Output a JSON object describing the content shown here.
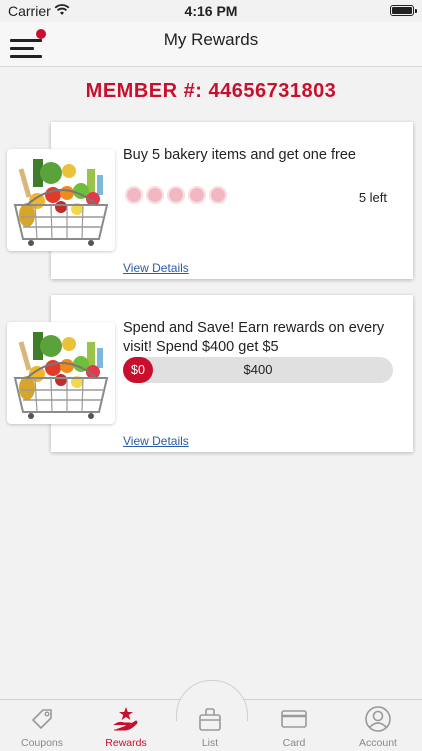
{
  "status": {
    "carrier": "Carrier",
    "time": "4:16 PM"
  },
  "nav": {
    "title": "My Rewards",
    "menu_icon": "hamburger-menu-icon",
    "notification_dot_color": "#c8102e"
  },
  "member": {
    "label": "MEMBER #: 44656731803"
  },
  "rewards": [
    {
      "description": "Buy 5 bakery items and get one free",
      "punches_total": 5,
      "punches_filled": 0,
      "remaining": "5 left",
      "link": "View Details",
      "image": "grocery-basket-image"
    },
    {
      "description": "Spend and Save! Earn rewards on every visit! Spend $400 get $5",
      "progress_current": "$0",
      "progress_goal": "$400",
      "progress_fraction": 0,
      "link": "View Details",
      "image": "grocery-basket-image"
    }
  ],
  "tabs": [
    {
      "label": "Coupons",
      "icon": "tag-icon",
      "active": false
    },
    {
      "label": "Rewards",
      "icon": "hand-star-icon",
      "active": true
    },
    {
      "label": "List",
      "icon": "bag-icon",
      "active": false
    },
    {
      "label": "Card",
      "icon": "card-icon",
      "active": false
    },
    {
      "label": "Account",
      "icon": "account-icon",
      "active": false
    }
  ],
  "colors": {
    "accent": "#c8102e",
    "link": "#2a5caa"
  }
}
